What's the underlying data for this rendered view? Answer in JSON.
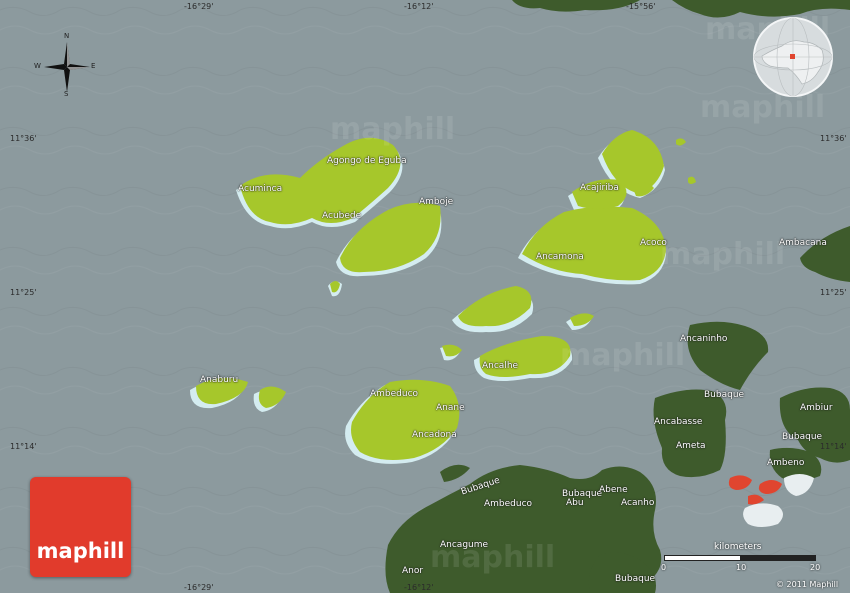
{
  "map": {
    "brand": "maphill",
    "watermarks": [
      "maphill",
      "maphill",
      "maphill",
      "maphill",
      "maphill",
      "maphill"
    ],
    "colors": {
      "water": "#8c9a9e",
      "selected_land": "#a6c72b",
      "land_shadow": "#d4ecf0",
      "other_land": "#3e5b2c",
      "logo": "#e13b2c",
      "highlight": "#e0452f"
    },
    "coordinates": {
      "top": [
        "-16°29'",
        "-16°12'",
        "-15°56'"
      ],
      "bottom": [
        "-16°29'",
        "-16°12'"
      ],
      "left": [
        "11°36'",
        "11°25'",
        "11°14'"
      ],
      "right": [
        "11°36'",
        "11°25'",
        "11°14'"
      ]
    },
    "compass": {
      "n": "N",
      "s": "S",
      "e": "E",
      "w": "W"
    },
    "places": [
      "Agongo de Eguba",
      "Acuminca",
      "Acubede",
      "Amboje",
      "Acajiriba",
      "Ancamona",
      "Acoco",
      "Ambacana",
      "Ancaninho",
      "Anaburu",
      "Ancalhe",
      "Ambeduco",
      "Anane",
      "Ancadona",
      "Bubaque",
      "Ambiur",
      "Ancabasse",
      "Bubaque",
      "Ameta",
      "Ambeno",
      "Bubaque",
      "Ambeduco",
      "Bubaque",
      "Abu",
      "Abene",
      "Acanho",
      "Ancagume",
      "Anor",
      "Bubaque"
    ],
    "scale": {
      "units": "kilometers",
      "ticks": [
        "0",
        "10",
        "20"
      ]
    },
    "copyright": "© 2011 Maphill"
  }
}
